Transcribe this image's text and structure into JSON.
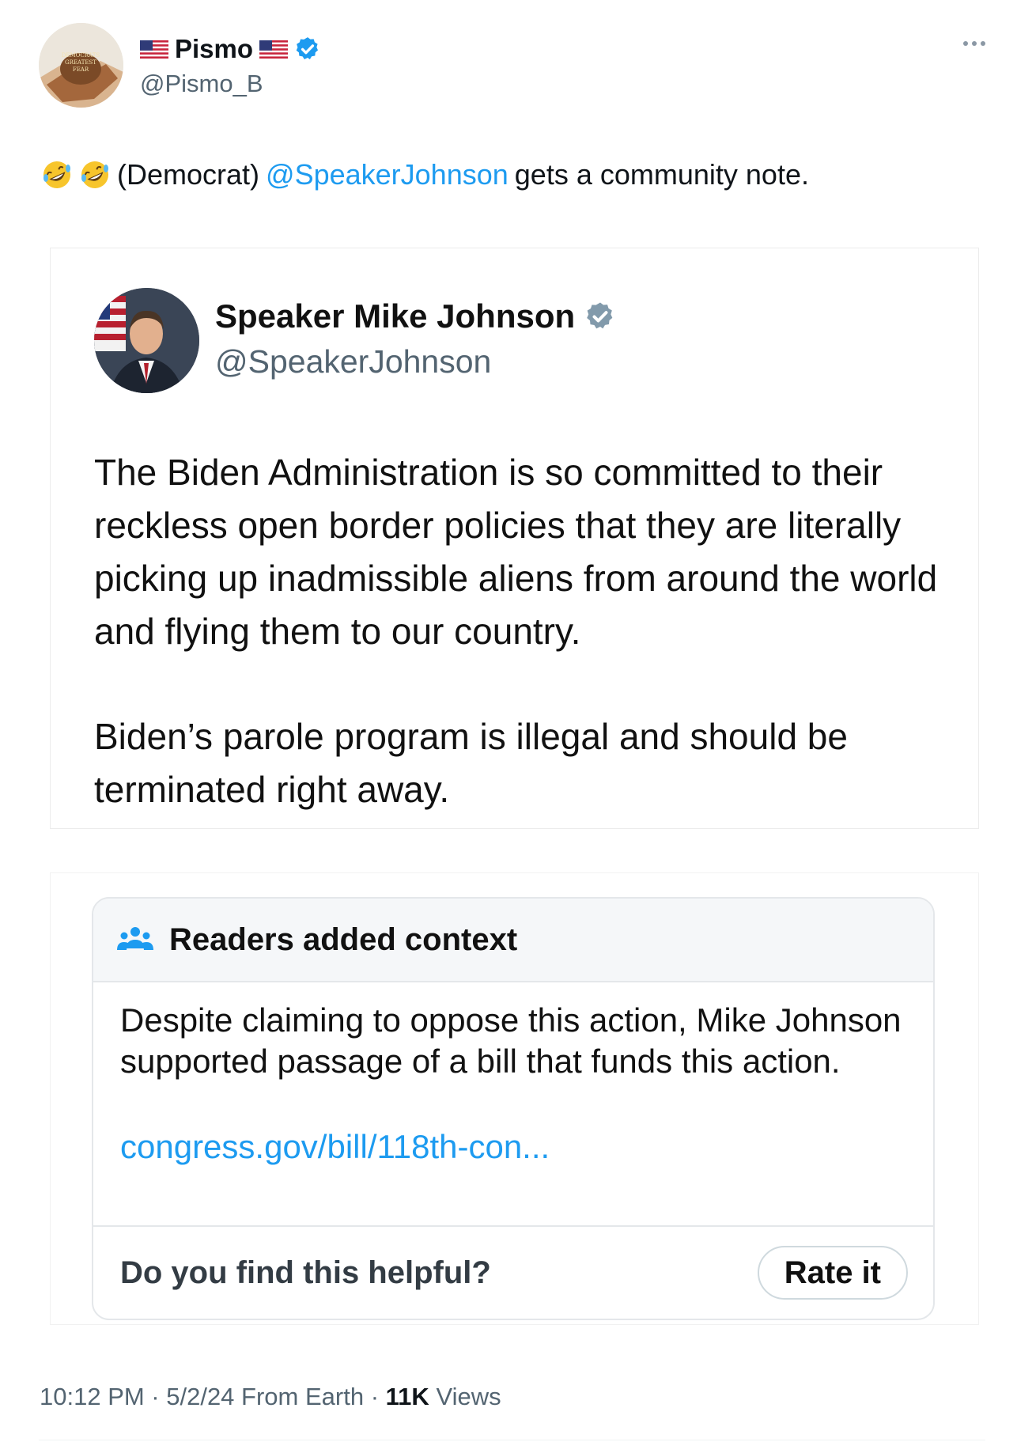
{
  "tweet": {
    "author": {
      "display_name": "Pismo",
      "handle": "@Pismo_B",
      "flag_icon": "us-flag-icon",
      "verified_icon": "verified-badge-icon",
      "avatar_caption": [
        "DEMOCRATS",
        "GREATEST",
        "FEAR"
      ]
    },
    "text": {
      "emoji": "rolling-on-floor-laughing-emoji",
      "prefix": "(Democrat)",
      "mention": "@SpeakerJohnson",
      "suffix": "gets a community note."
    },
    "timestamp": "10:12 PM · 5/2/24 From Earth",
    "separator": "·",
    "views_count": "11K",
    "views_label": "Views"
  },
  "embedded_tweet": {
    "display_name": "Speaker Mike Johnson",
    "handle": "@SpeakerJohnson",
    "paragraph_1": "The Biden Administration is so committed to their reckless open border policies that they are literally picking up inadmissible aliens from around the world and flying them to our country.",
    "paragraph_2": "Biden’s parole program is illegal and should be terminated right away."
  },
  "community_note": {
    "title": "Readers added context",
    "body": "Despite claiming to oppose this action, Mike Johnson supported passage of a bill that funds this action.",
    "link": "congress.gov/bill/118th-con...",
    "helpful_question": "Do you find this helpful?",
    "rate_button": "Rate it"
  },
  "colors": {
    "accent": "#1d9bf0",
    "text_primary": "#0f1419",
    "text_secondary": "#536471"
  }
}
